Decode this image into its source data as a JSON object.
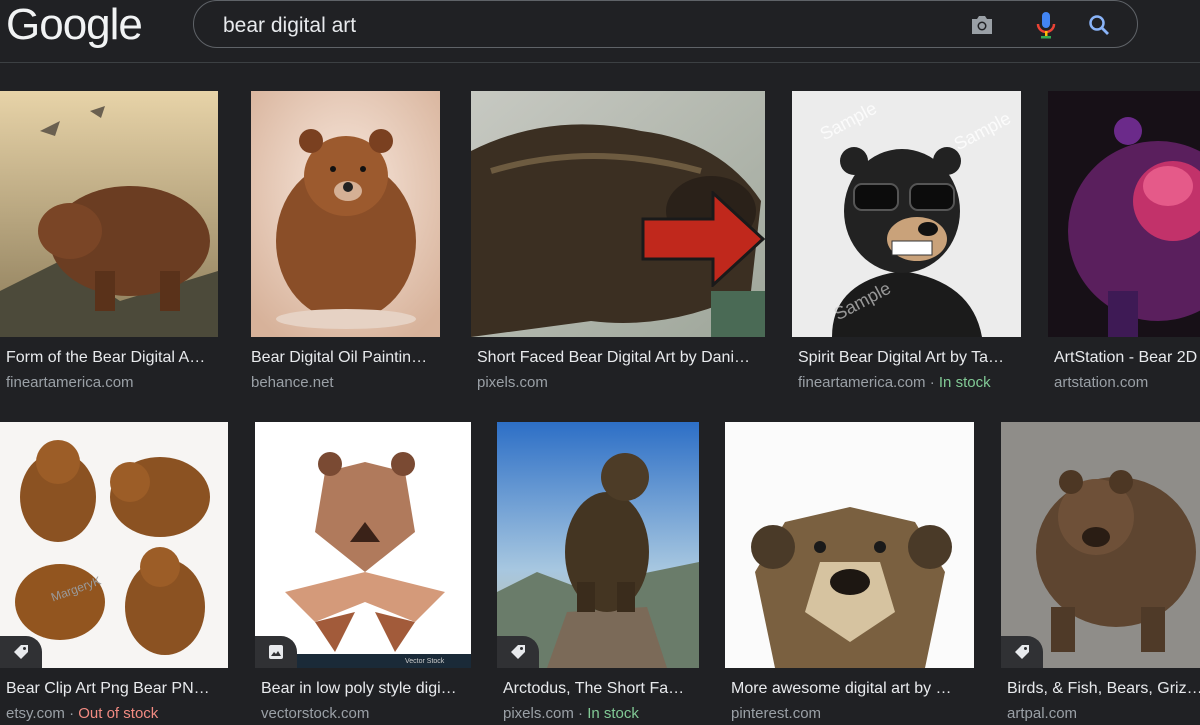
{
  "logo": "Google",
  "search": {
    "query": "bear digital art"
  },
  "icons": {
    "camera": "camera-icon",
    "mic": "mic-icon",
    "search": "search-icon",
    "tag": "tag-icon",
    "image": "image-icon"
  },
  "colors": {
    "background": "#202124",
    "in_stock": "#81c995",
    "out_of_stock": "#f28b82",
    "arrow": "#c0281c"
  },
  "row1": [
    {
      "title": "Form of the Bear Digital A…",
      "source": "fineartamerica.com",
      "stock": ""
    },
    {
      "title": "Bear Digital Oil Paintin…",
      "source": "behance.net",
      "stock": ""
    },
    {
      "title": "Short Faced Bear Digital Art by Dani…",
      "source": "pixels.com",
      "stock": ""
    },
    {
      "title": "Spirit Bear Digital Art by Ta…",
      "source": "fineartamerica.com",
      "stock": "In stock"
    },
    {
      "title": "ArtStation - Bear 2D",
      "source": "artstation.com",
      "stock": ""
    }
  ],
  "row2": [
    {
      "title": "Bear Clip Art Png Bear PN…",
      "source": "etsy.com",
      "stock": "Out of stock"
    },
    {
      "title": "Bear in low poly style digi…",
      "source": "vectorstock.com",
      "stock": ""
    },
    {
      "title": "Arctodus, The Short Fa…",
      "source": "pixels.com",
      "stock": "In stock"
    },
    {
      "title": "More awesome digital art by …",
      "source": "pinterest.com",
      "stock": ""
    },
    {
      "title": "Birds, & Fish, Bears, Griz…",
      "source": "artpal.com",
      "stock": ""
    }
  ],
  "watermarks": {
    "sample": "Sample",
    "vector": "Vector Stock",
    "margery": "MargeryK"
  },
  "separator": " · "
}
